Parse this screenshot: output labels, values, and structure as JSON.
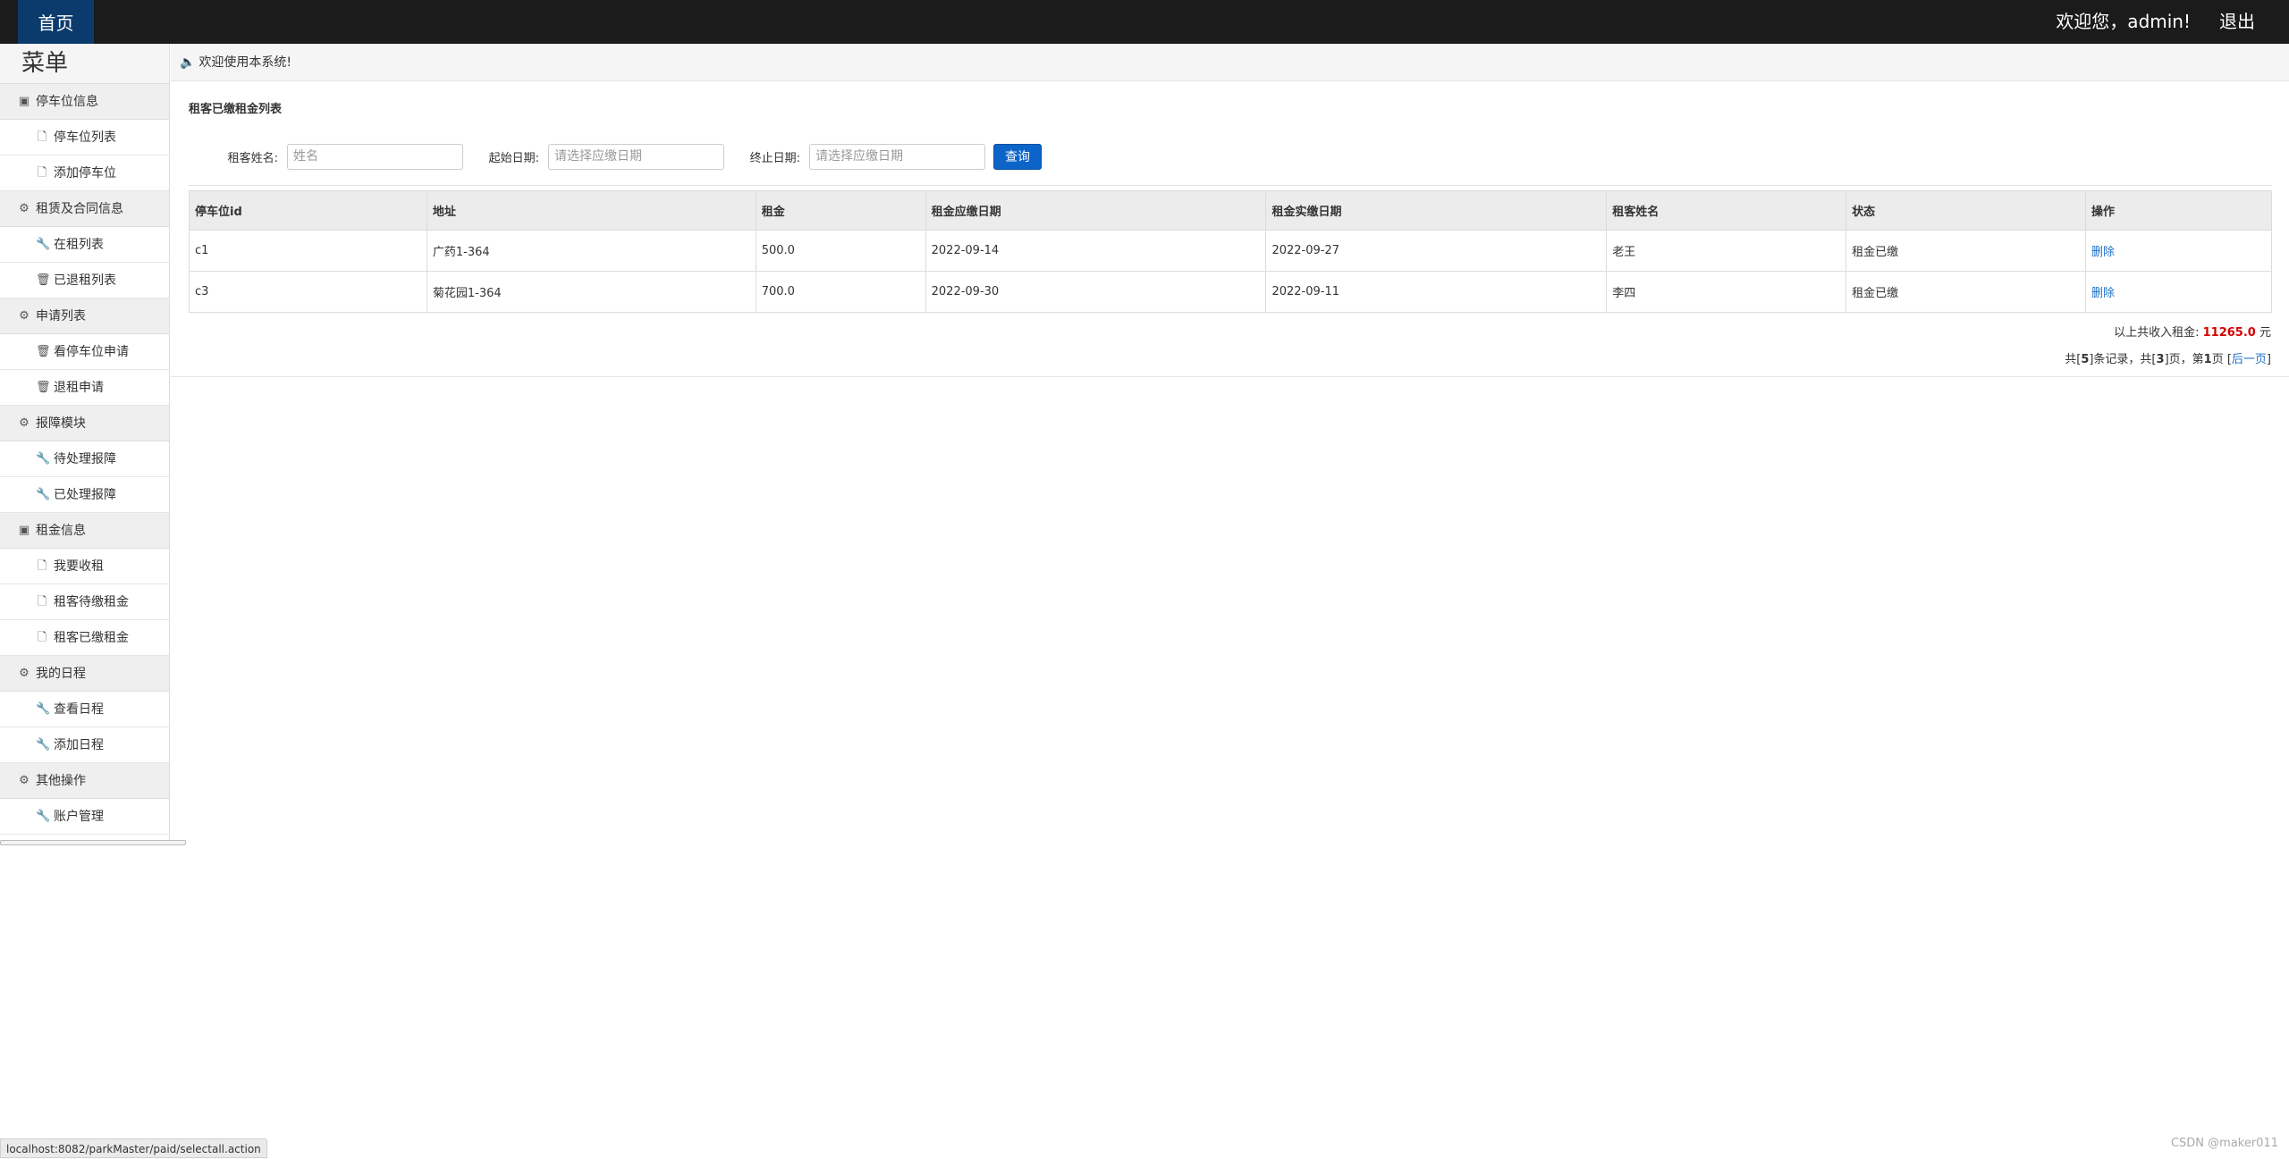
{
  "topbar": {
    "home_label": "首页",
    "welcome": "欢迎您，admin!",
    "logout_label": "退出"
  },
  "sidebar": {
    "title": "菜单",
    "groups": [
      {
        "label": "停车位信息",
        "icon": "image-icon",
        "items": [
          {
            "label": "停车位列表",
            "icon": "file-icon"
          },
          {
            "label": "添加停车位",
            "icon": "file-icon"
          }
        ]
      },
      {
        "label": "租赁及合同信息",
        "icon": "gear-icon",
        "items": [
          {
            "label": "在租列表",
            "icon": "wrench-icon"
          },
          {
            "label": "已退租列表",
            "icon": "trash-icon"
          }
        ]
      },
      {
        "label": "申请列表",
        "icon": "gear-icon",
        "items": [
          {
            "label": "看停车位申请",
            "icon": "trash-icon"
          },
          {
            "label": "退租申请",
            "icon": "trash-icon"
          }
        ]
      },
      {
        "label": "报障模块",
        "icon": "gear-icon",
        "items": [
          {
            "label": "待处理报障",
            "icon": "wrench-icon"
          },
          {
            "label": "已处理报障",
            "icon": "wrench-icon"
          }
        ]
      },
      {
        "label": "租金信息",
        "icon": "image-icon",
        "items": [
          {
            "label": "我要收租",
            "icon": "file-icon"
          },
          {
            "label": "租客待缴租金",
            "icon": "file-icon"
          },
          {
            "label": "租客已缴租金",
            "icon": "file-icon"
          }
        ]
      },
      {
        "label": "我的日程",
        "icon": "gear-icon",
        "items": [
          {
            "label": "查看日程",
            "icon": "wrench-icon"
          },
          {
            "label": "添加日程",
            "icon": "wrench-icon"
          }
        ]
      },
      {
        "label": "其他操作",
        "icon": "gear-icon",
        "items": [
          {
            "label": "账户管理",
            "icon": "wrench-icon"
          }
        ]
      }
    ]
  },
  "main": {
    "notice": "欢迎使用本系统!",
    "page_title": "租客已缴租金列表",
    "filters": {
      "name_label": "租客姓名:",
      "name_placeholder": "姓名",
      "start_label": "起始日期:",
      "start_placeholder": "请选择应缴日期",
      "end_label": "终止日期:",
      "end_placeholder": "请选择应缴日期",
      "query_label": "查询"
    },
    "table": {
      "headers": [
        "停车位id",
        "地址",
        "租金",
        "租金应缴日期",
        "租金实缴日期",
        "租客姓名",
        "状态",
        "操作"
      ],
      "rows": [
        [
          "c1",
          "广药1-364",
          "500.0",
          "2022-09-14",
          "2022-09-27",
          "老王",
          "租金已缴",
          "删除"
        ],
        [
          "c3",
          "菊花园1-364",
          "700.0",
          "2022-09-30",
          "2022-09-11",
          "李四",
          "租金已缴",
          "删除"
        ]
      ]
    },
    "summary": {
      "prefix": "以上共收入租金:",
      "amount": "11265.0",
      "unit": "元"
    },
    "pager": {
      "t1": "共[",
      "records": "5",
      "t2": "]条记录，共[",
      "pages": "3",
      "t3": "]页，第",
      "current": "1",
      "t4": "页 [",
      "next_label": "后一页",
      "t5": "]"
    }
  },
  "statusbar": {
    "url": "localhost:8082/parkMaster/paid/selectall.action"
  },
  "watermark": "CSDN @maker011",
  "colors": {
    "topbar": "#1b1b1b",
    "home": "#0b3b6c",
    "query_btn": "#0d64c8",
    "amount": "#d40000",
    "link": "#1b6fc5"
  }
}
